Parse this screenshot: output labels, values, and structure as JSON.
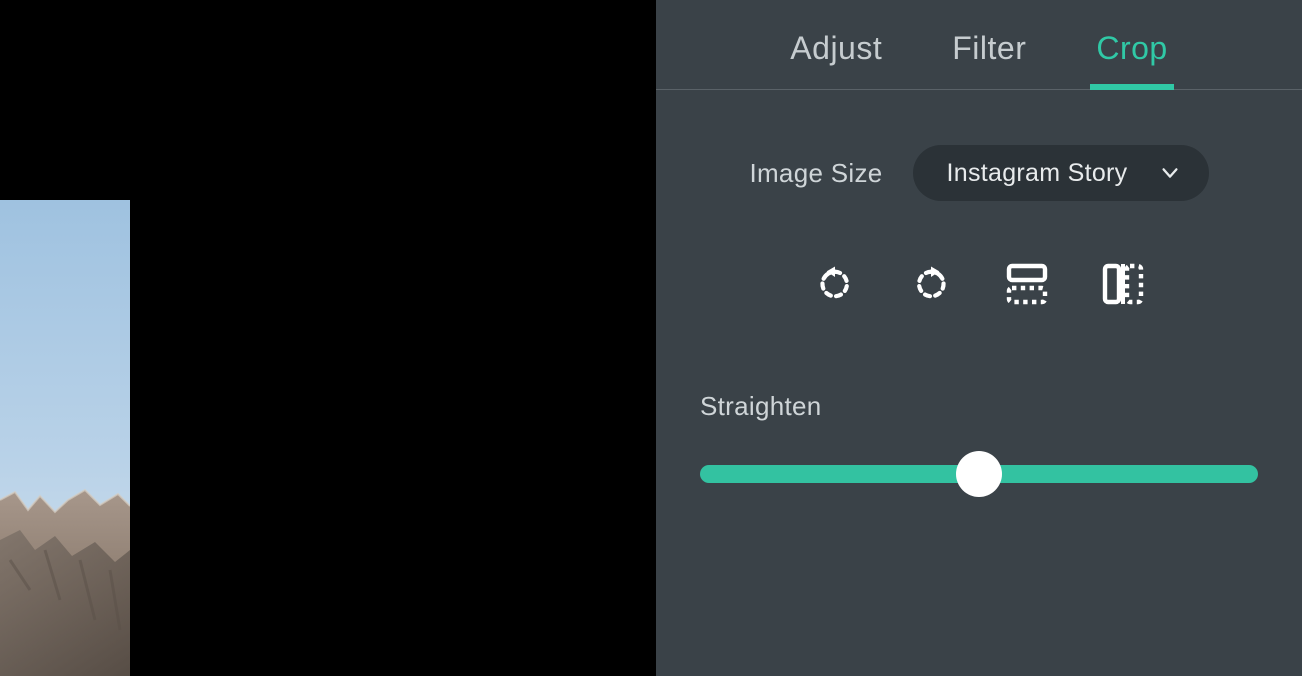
{
  "tabs": {
    "adjust": "Adjust",
    "filter": "Filter",
    "crop": "Crop",
    "active": "crop"
  },
  "imageSize": {
    "label": "Image Size",
    "selected": "Instagram Story"
  },
  "tools": {
    "rotateLeft": "rotate-left",
    "rotateRight": "rotate-right",
    "flipHorizontal": "flip-horizontal",
    "flipVertical": "flip-vertical"
  },
  "straighten": {
    "label": "Straighten",
    "valuePercent": 50
  },
  "colors": {
    "accent": "#30c9a6",
    "panel": "#3a4248",
    "dropdown": "#2b3237"
  }
}
